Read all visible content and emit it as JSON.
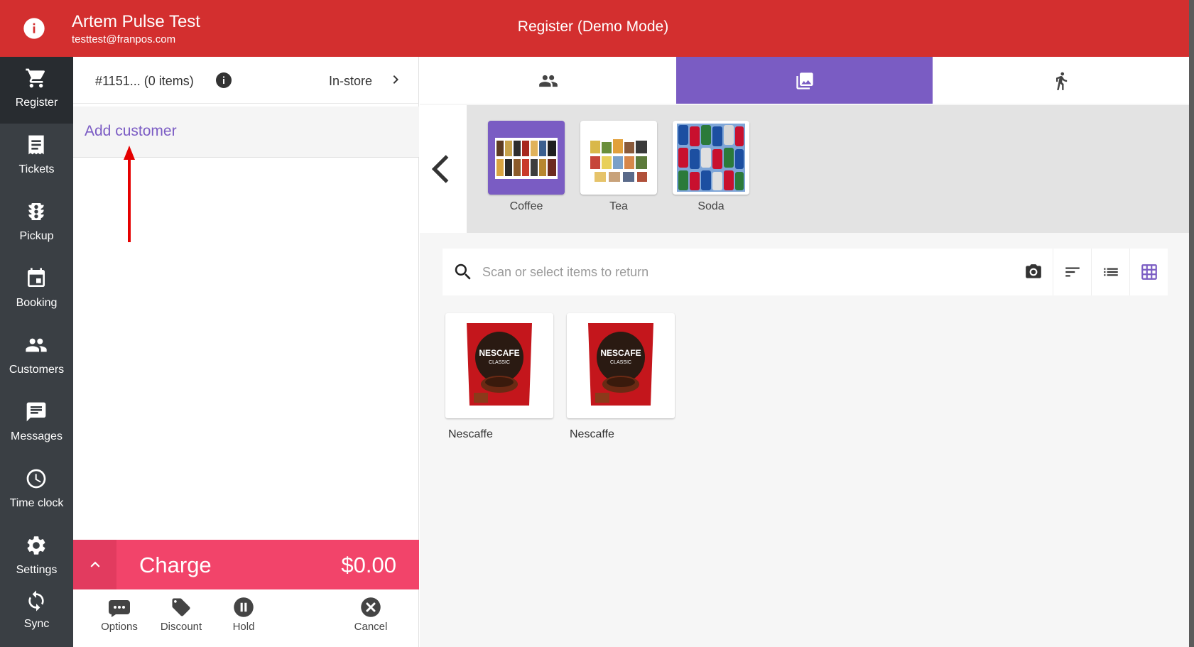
{
  "header": {
    "account_name": "Artem  Pulse Test",
    "account_email": "testtest@franpos.com",
    "title": "Register  (Demo Mode)",
    "color": "#d32f2f"
  },
  "sidebar": {
    "items": [
      {
        "label": "Register",
        "icon": "cart-icon",
        "active": true
      },
      {
        "label": "Tickets",
        "icon": "receipt-icon"
      },
      {
        "label": "Pickup",
        "icon": "traffic-light-icon"
      },
      {
        "label": "Booking",
        "icon": "calendar-icon"
      },
      {
        "label": "Customers",
        "icon": "people-icon"
      },
      {
        "label": "Messages",
        "icon": "message-icon"
      },
      {
        "label": "Time clock",
        "icon": "clock-icon"
      },
      {
        "label": "Settings",
        "icon": "gear-icon"
      },
      {
        "label": "Sync",
        "icon": "sync-icon"
      }
    ]
  },
  "ticket": {
    "id": "#1151... (0 items)",
    "mode": "In-store",
    "add_customer": "Add customer",
    "charge_label": "Charge",
    "charge_total": "$0.00",
    "actions": [
      {
        "label": "Options",
        "icon": "more-icon"
      },
      {
        "label": "Discount",
        "icon": "tag-icon"
      },
      {
        "label": "Hold",
        "icon": "pause-icon"
      },
      {
        "label": "Cancel",
        "icon": "cancel-icon"
      }
    ]
  },
  "tabs": [
    {
      "icon": "people-icon"
    },
    {
      "icon": "photo-library-icon",
      "active": true
    },
    {
      "icon": "walking-person-icon"
    }
  ],
  "categories": [
    {
      "label": "Coffee",
      "active": true
    },
    {
      "label": "Tea"
    },
    {
      "label": "Soda"
    }
  ],
  "search": {
    "placeholder": "Scan or select items to return"
  },
  "products": [
    {
      "label": "Nescaffe"
    },
    {
      "label": "Nescaffe"
    }
  ],
  "colors": {
    "accent": "#7a5cc3",
    "charge": "#f2446a",
    "sidebar": "#3a3f44"
  }
}
